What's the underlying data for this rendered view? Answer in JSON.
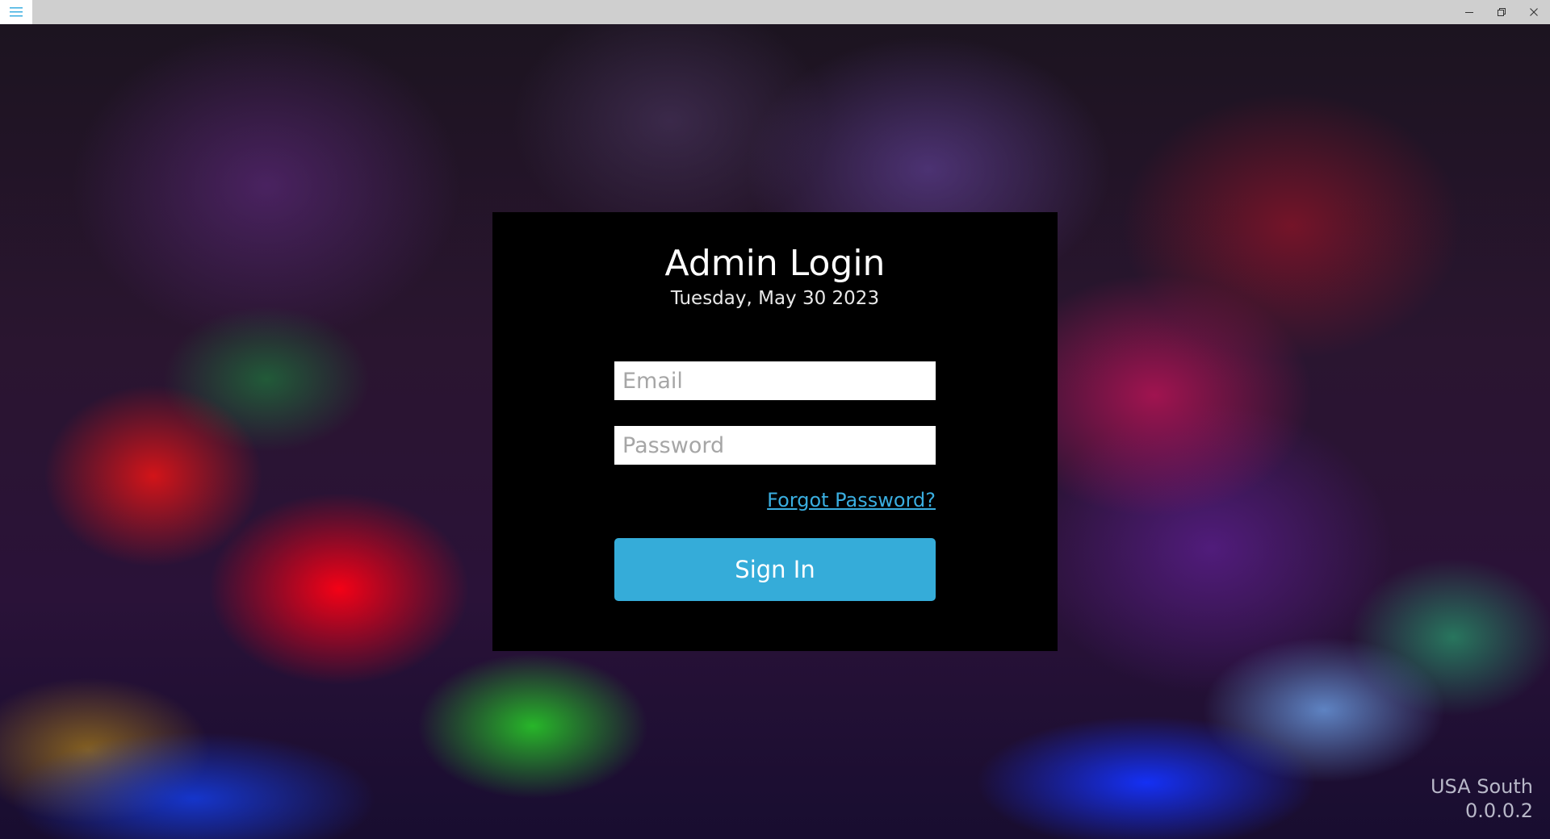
{
  "titlebar": {
    "menu_icon": "hamburger-menu-icon",
    "minimize_icon": "minimize-icon",
    "restore_icon": "restore-icon",
    "close_icon": "close-icon"
  },
  "login": {
    "title": "Admin Login",
    "date": "Tuesday, May 30 2023",
    "email_placeholder": "Email",
    "email_value": "",
    "password_placeholder": "Password",
    "password_value": "",
    "forgot_label": "Forgot Password?",
    "signin_label": "Sign In"
  },
  "footer": {
    "region": "USA South",
    "version": "0.0.0.2"
  },
  "colors": {
    "accent": "#35acd9",
    "link": "#3aaee0",
    "panel": "#000000",
    "titlebar": "#cfcfcf"
  }
}
